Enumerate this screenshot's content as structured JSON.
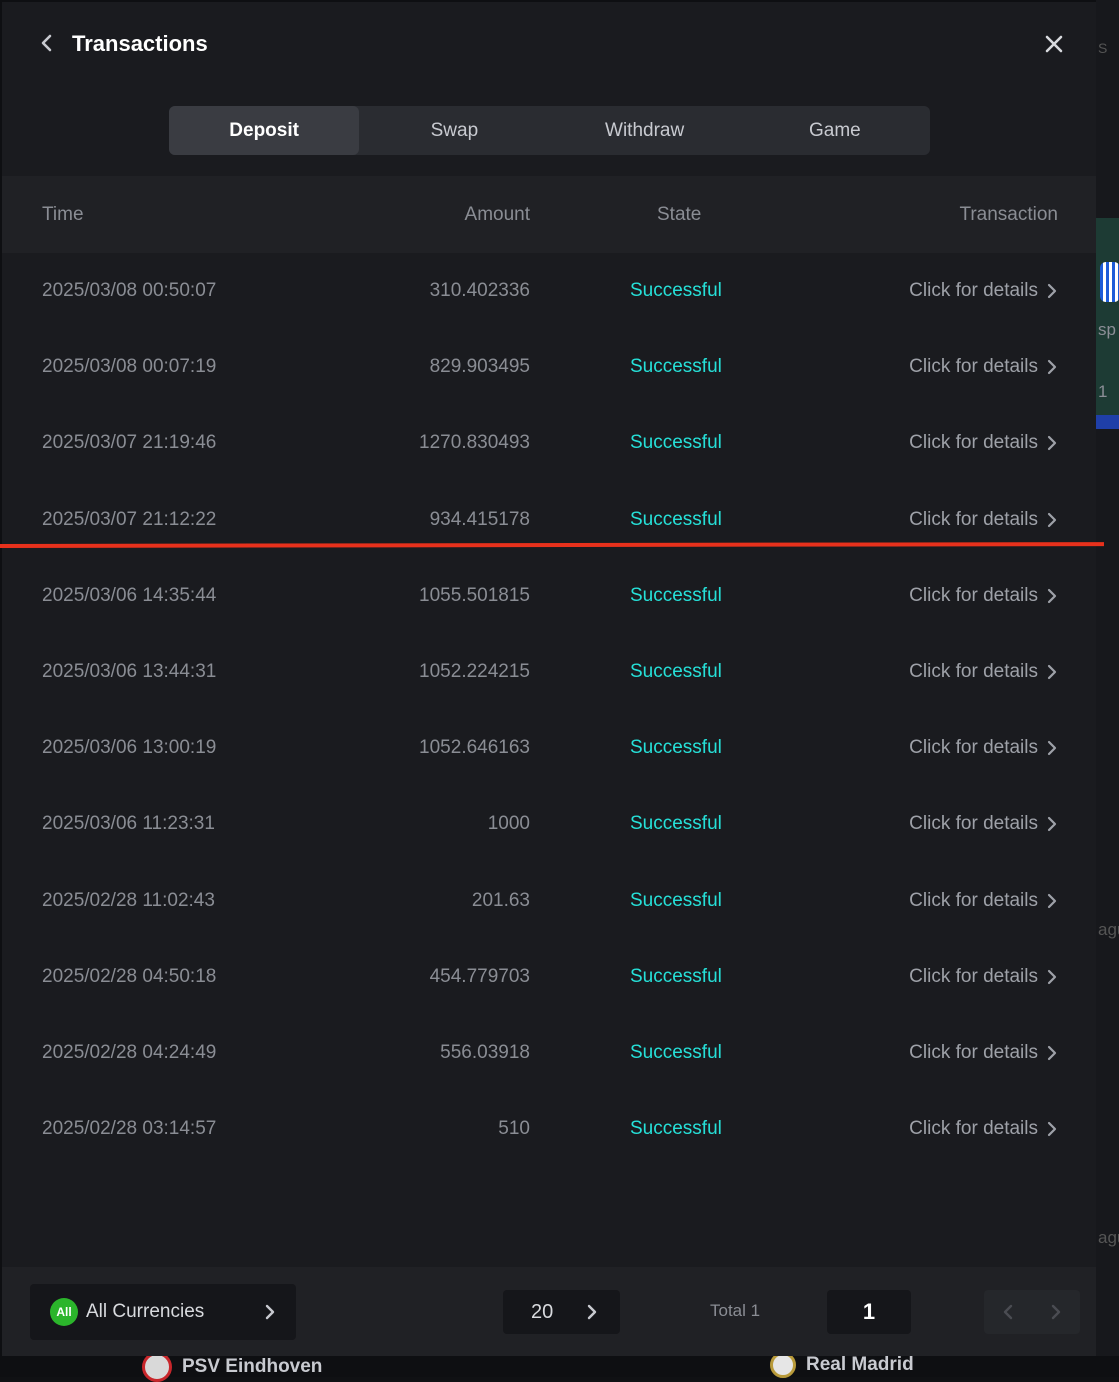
{
  "header": {
    "title": "Transactions"
  },
  "tabs": [
    {
      "label": "Deposit",
      "active": true
    },
    {
      "label": "Swap",
      "active": false
    },
    {
      "label": "Withdraw",
      "active": false
    },
    {
      "label": "Game",
      "active": false
    }
  ],
  "table": {
    "columns": {
      "time": "Time",
      "amount": "Amount",
      "state": "State",
      "transaction": "Transaction"
    },
    "rows": [
      {
        "time": "2025/03/08 00:50:07",
        "amount": "310.402336",
        "state": "Successful",
        "link": "Click for details"
      },
      {
        "time": "2025/03/08 00:07:19",
        "amount": "829.903495",
        "state": "Successful",
        "link": "Click for details"
      },
      {
        "time": "2025/03/07 21:19:46",
        "amount": "1270.830493",
        "state": "Successful",
        "link": "Click for details"
      },
      {
        "time": "2025/03/07 21:12:22",
        "amount": "934.415178",
        "state": "Successful",
        "link": "Click for details"
      },
      {
        "time": "2025/03/06 14:35:44",
        "amount": "1055.501815",
        "state": "Successful",
        "link": "Click for details"
      },
      {
        "time": "2025/03/06 13:44:31",
        "amount": "1052.224215",
        "state": "Successful",
        "link": "Click for details"
      },
      {
        "time": "2025/03/06 13:00:19",
        "amount": "1052.646163",
        "state": "Successful",
        "link": "Click for details"
      },
      {
        "time": "2025/03/06 11:23:31",
        "amount": "1000",
        "state": "Successful",
        "link": "Click for details"
      },
      {
        "time": "2025/02/28 11:02:43",
        "amount": "201.63",
        "state": "Successful",
        "link": "Click for details"
      },
      {
        "time": "2025/02/28 04:50:18",
        "amount": "454.779703",
        "state": "Successful",
        "link": "Click for details"
      },
      {
        "time": "2025/02/28 04:24:49",
        "amount": "556.03918",
        "state": "Successful",
        "link": "Click for details"
      },
      {
        "time": "2025/02/28 03:14:57",
        "amount": "510",
        "state": "Successful",
        "link": "Click for details"
      }
    ]
  },
  "footer": {
    "currency_badge": "All",
    "currency_label": "All Currencies",
    "page_size": "20",
    "total_label": "Total 1",
    "current_page": "1"
  },
  "background": {
    "team_left": "PSV Eindhoven",
    "team_right": "Real Madrid",
    "frag_1": "S",
    "frag_2": "sp",
    "frag_3": "1",
    "frag_4": "agu",
    "frag_5": "agu"
  },
  "colors": {
    "accent_success": "#26e0d8",
    "annotation_line": "#e8311c",
    "currency_badge": "#2bb52b"
  }
}
